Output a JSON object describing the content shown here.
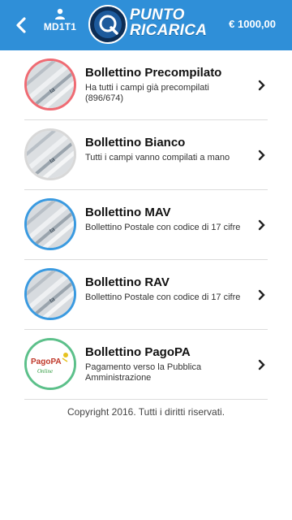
{
  "header": {
    "back_icon": "chevron-left-icon",
    "user_icon": "user-icon",
    "user_code": "MD1T1",
    "logo_line1": "PUNTO",
    "logo_line2": "RICARICA",
    "balance": "€ 1000,00",
    "color": "#2f8fd8"
  },
  "items": [
    {
      "title": "Bollettino Precompilato",
      "desc": "Ha tutti i campi già precompilati (896/674)",
      "ring": "#ef6b73",
      "icon": "bill-photo-icon"
    },
    {
      "title": "Bollettino Bianco",
      "desc": "Tutti i campi vanno compilati a mano",
      "ring": "#d8d8d8",
      "icon": "bill-photo-icon"
    },
    {
      "title": "Bollettino MAV",
      "desc": "Bollettino Postale con codice di 17 cifre",
      "ring": "#3a9ae0",
      "icon": "bill-photo-icon"
    },
    {
      "title": "Bollettino RAV",
      "desc": "Bollettino Postale con codice di 17 cifre",
      "ring": "#3a9ae0",
      "icon": "bill-photo-icon"
    },
    {
      "title": "Bollettino PagoPA",
      "desc": "Pagamento verso la Pubblica Amministrazione",
      "ring": "#5cc08a",
      "icon": "pagopa-logo-icon",
      "logo_text1": "PagoPA",
      "logo_text2": "Online"
    }
  ],
  "footer": "Copyright 2016. Tutti i diritti riservati."
}
